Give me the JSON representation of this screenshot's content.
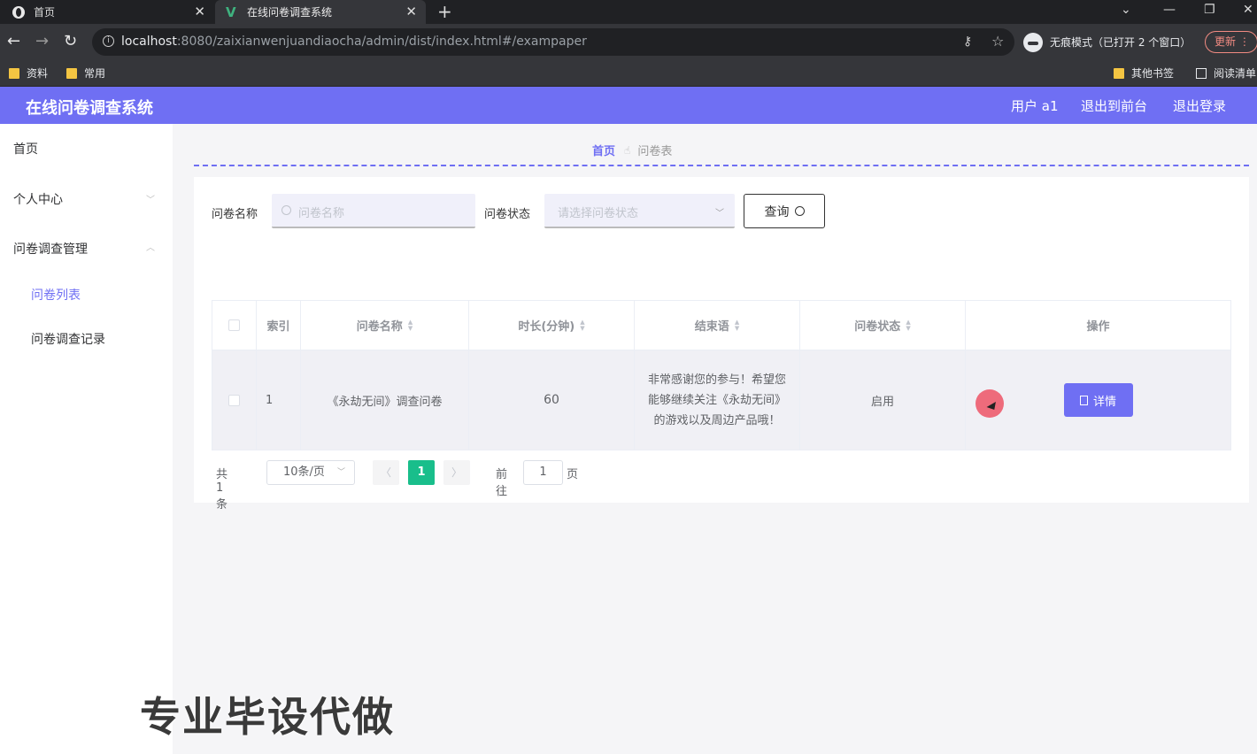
{
  "browser": {
    "tabs": [
      {
        "title": "首页",
        "icon": "globe-icon"
      },
      {
        "title": "在线问卷调查系统",
        "icon": "vue-logo-icon"
      }
    ],
    "url_host": "localhost",
    "url_rest": ":8080/zaixianwenjuandiaocha/admin/dist/index.html#/exampaper",
    "incognito_label": "无痕模式（已打开 2 个窗口）",
    "update_label": "更新",
    "bookmarks": [
      "资料",
      "常用"
    ],
    "other_bookmarks": "其他书签",
    "reading_list": "阅读清单"
  },
  "header": {
    "title": "在线问卷调查系统",
    "user": "用户 a1",
    "to_front": "退出到前台",
    "logout": "退出登录",
    "color": "#6f6ff3"
  },
  "sidebar": {
    "items": [
      {
        "label": "首页"
      },
      {
        "label": "个人中心"
      },
      {
        "label": "问卷调查管理"
      }
    ],
    "sub_items": [
      {
        "label": "问卷列表",
        "active": true
      },
      {
        "label": "问卷调查记录",
        "active": false
      }
    ]
  },
  "breadcrumb": {
    "home": "首页",
    "current": "问卷表"
  },
  "search": {
    "name_label": "问卷名称",
    "name_placeholder": "问卷名称",
    "status_label": "问卷状态",
    "status_placeholder": "请选择问卷状态",
    "query_label": "查询"
  },
  "table": {
    "headers": {
      "index": "索引",
      "name": "问卷名称",
      "duration": "时长(分钟)",
      "ending": "结束语",
      "status": "问卷状态",
      "action": "操作"
    },
    "rows": [
      {
        "index": "1",
        "name": "《永劫无间》调查问卷",
        "duration": "60",
        "ending": "非常感谢您的参与！希望您能够继续关注《永劫无间》的游戏以及周边产品哦！",
        "status": "启用",
        "detail_label": "详情"
      }
    ]
  },
  "pagination": {
    "total": "共 1 条",
    "page_size": "10条/页",
    "current_page": "1",
    "goto_prefix": "前往",
    "goto_value": "1",
    "goto_suffix": "页"
  },
  "watermark": "专业毕设代做"
}
